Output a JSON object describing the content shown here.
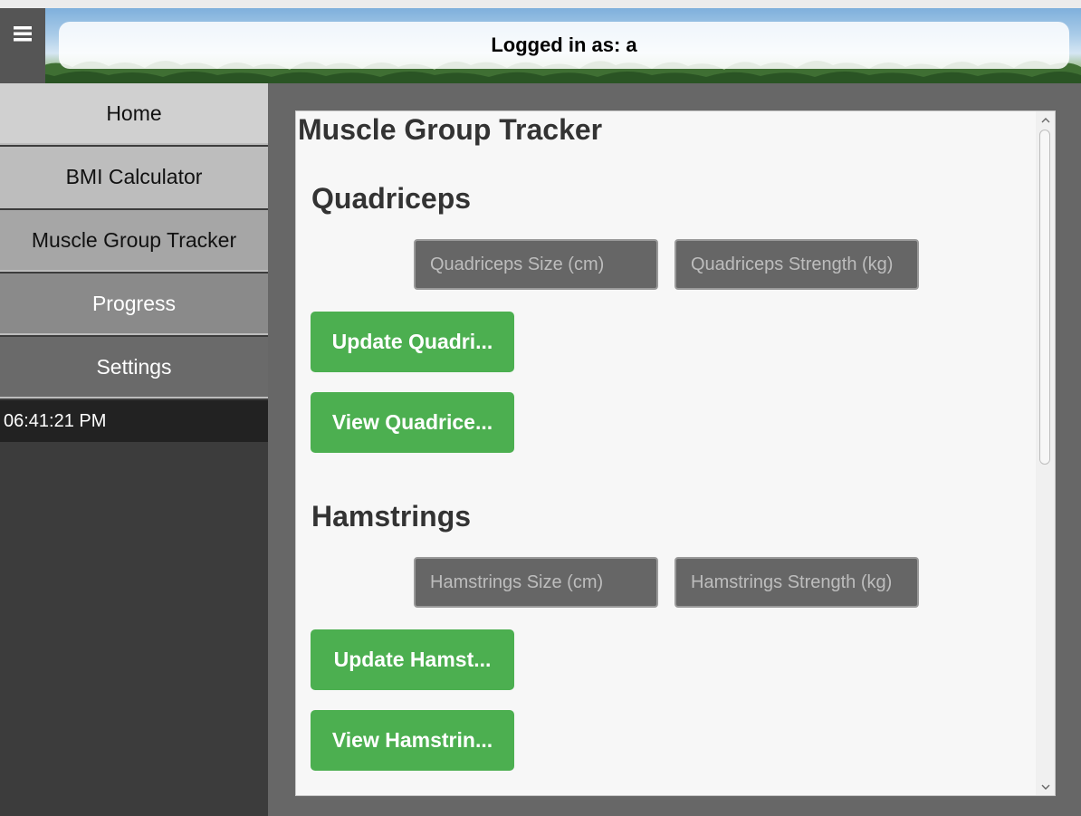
{
  "header": {
    "menu_icon": "hamburger-menu-icon",
    "login_text": "Logged in as: a"
  },
  "sidebar": {
    "items": [
      {
        "label": "Home"
      },
      {
        "label": "BMI Calculator"
      },
      {
        "label": "Muscle Group Tracker"
      },
      {
        "label": "Progress"
      },
      {
        "label": "Settings"
      }
    ],
    "clock": "06:41:21 PM"
  },
  "main": {
    "title": "Muscle Group Tracker",
    "sections": [
      {
        "title": "Quadriceps",
        "size_placeholder": "Quadriceps Size (cm)",
        "strength_placeholder": "Quadriceps Strength (kg)",
        "update_label": "Update Quadri...",
        "view_label": "View Quadrice..."
      },
      {
        "title": "Hamstrings",
        "size_placeholder": "Hamstrings Size (cm)",
        "strength_placeholder": "Hamstrings Strength (kg)",
        "update_label": "Update Hamst...",
        "view_label": "View Hamstrin..."
      }
    ]
  },
  "scrollbar": {
    "up_icon": "chevron-up-icon",
    "down_icon": "chevron-down-icon"
  },
  "colors": {
    "accent_green": "#4caf50",
    "field_bg": "#666666",
    "panel_bg": "#f7f7f7",
    "main_bg": "#676767",
    "sidebar_bg": "#3c3c3c"
  }
}
